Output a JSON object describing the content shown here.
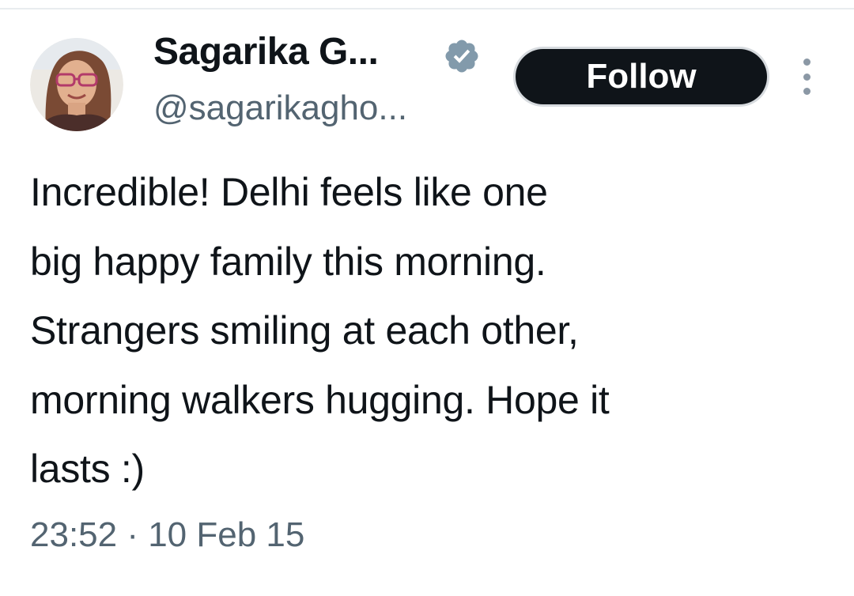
{
  "tweet": {
    "author": {
      "display_name": "Sagarika G...",
      "handle": "@sagarikagho...",
      "verified": true,
      "avatar": "profile-photo"
    },
    "follow_label": "Follow",
    "text_lines": [
      "Incredible! Delhi feels like one",
      "big happy family this morning.",
      "Strangers smiling at each other,",
      "morning walkers hugging. Hope it",
      "lasts :)"
    ],
    "timestamp": "23:52 · 10 Feb 15"
  },
  "icons": {
    "verified": "verified-badge-icon",
    "more": "more-vertical-icon"
  },
  "colors": {
    "text": "#0f1419",
    "secondary_text": "#536471",
    "follow_button_bg": "#0f1419",
    "follow_button_text": "#ffffff",
    "verified_badge": "#829aab"
  }
}
